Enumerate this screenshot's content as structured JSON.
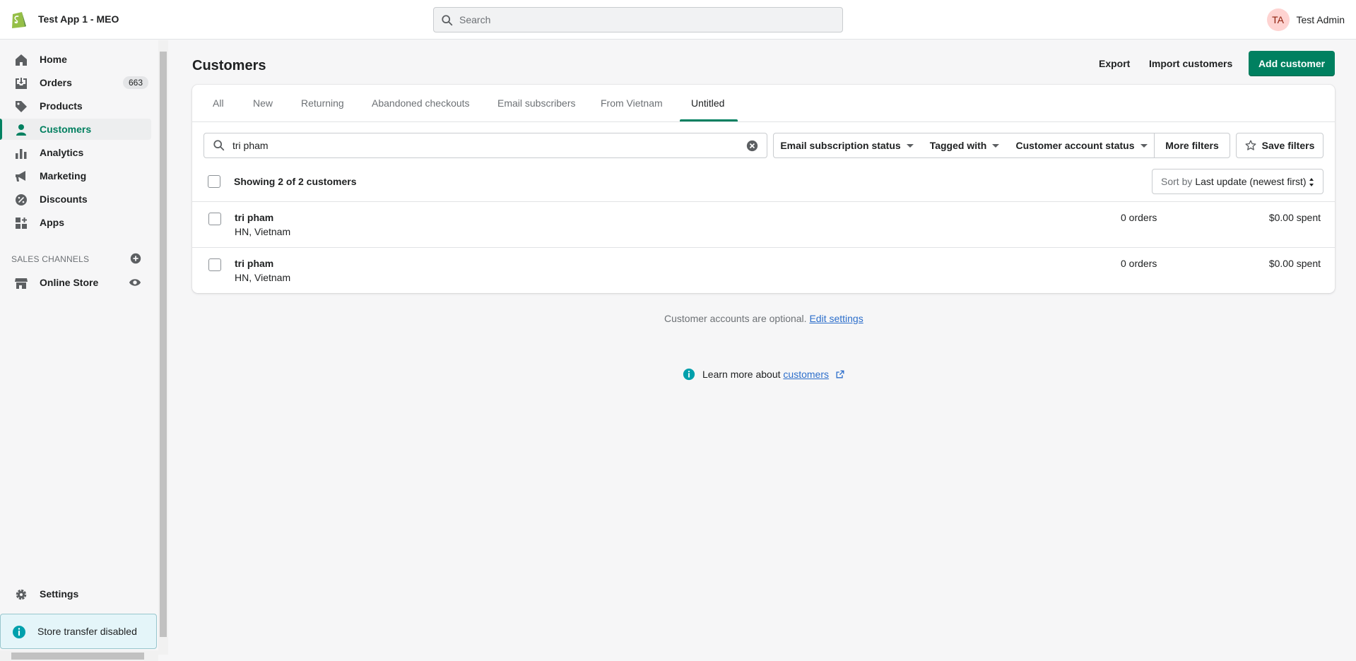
{
  "store": {
    "name": "Test App 1 - MEO"
  },
  "search": {
    "placeholder": "Search"
  },
  "user": {
    "initials": "TA",
    "name": "Test Admin"
  },
  "sidebar": {
    "items": [
      {
        "label": "Home",
        "icon": "home-icon"
      },
      {
        "label": "Orders",
        "icon": "orders-icon",
        "badge": "663"
      },
      {
        "label": "Products",
        "icon": "tag-icon"
      },
      {
        "label": "Customers",
        "icon": "person-icon",
        "active": true
      },
      {
        "label": "Analytics",
        "icon": "bar-chart-icon"
      },
      {
        "label": "Marketing",
        "icon": "megaphone-icon"
      },
      {
        "label": "Discounts",
        "icon": "discount-icon"
      },
      {
        "label": "Apps",
        "icon": "apps-icon"
      }
    ],
    "sales_channels_title": "SALES CHANNELS",
    "online_store": "Online Store",
    "settings": "Settings",
    "transfer_notice": "Store transfer disabled"
  },
  "page": {
    "title": "Customers",
    "export": "Export",
    "import": "Import customers",
    "add": "Add customer"
  },
  "tabs": [
    "All",
    "New",
    "Returning",
    "Abandoned checkouts",
    "Email subscribers",
    "From Vietnam",
    "Untitled"
  ],
  "active_tab": "Untitled",
  "filters": {
    "query": "tri pham",
    "email_status": "Email subscription status",
    "tagged": "Tagged with",
    "account_status": "Customer account status",
    "more": "More filters",
    "save": "Save filters"
  },
  "list": {
    "showing": "Showing 2 of 2 customers",
    "sort_label": "Sort by",
    "sort_value": "Last update (newest first)",
    "rows": [
      {
        "name": "tri pham",
        "location": "HN, Vietnam",
        "orders": "0 orders",
        "spent": "$0.00 spent"
      },
      {
        "name": "tri pham",
        "location": "HN, Vietnam",
        "orders": "0 orders",
        "spent": "$0.00 spent"
      }
    ]
  },
  "footer": {
    "note_text": "Customer accounts are optional.",
    "note_link": "Edit settings",
    "learn_text": "Learn more about",
    "learn_link": "customers"
  },
  "colors": {
    "accent": "#008060",
    "link": "#2c6ecb"
  }
}
